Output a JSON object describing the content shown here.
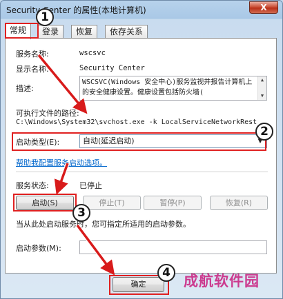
{
  "window": {
    "title": "Security Center 的属性(本地计算机)",
    "close_label": "X"
  },
  "tabs": [
    {
      "label": "常规",
      "active": true
    },
    {
      "label": "登录"
    },
    {
      "label": "恢复"
    },
    {
      "label": "依存关系"
    }
  ],
  "general": {
    "service_name_label": "服务名称:",
    "service_name_value": "wscsvc",
    "display_name_label": "显示名称:",
    "display_name_value": "Security Center",
    "description_label": "描述:",
    "description_text": "WSCSVC(Windows 安全中心)服务监视并报告计算机上的安全健康设置。健康设置包括防火墙(",
    "exe_path_label": "可执行文件的路径:",
    "exe_path_value": "C:\\Windows\\System32\\svchost.exe -k LocalServiceNetworkRest",
    "startup_type_label": "启动类型(E):",
    "startup_type_value": "自动(延迟启动)",
    "help_link": "帮助我配置服务启动选项。",
    "status_label": "服务状态:",
    "status_value": "已停止",
    "buttons": {
      "start": "启动(S)",
      "stop": "停止(T)",
      "pause": "暂停(P)",
      "resume": "恢复(R)"
    },
    "hint_text": "当从此处启动服务时，您可指定所适用的启动参数。",
    "params_label": "启动参数(M):"
  },
  "footer": {
    "ok_label": "确定"
  },
  "annotations": {
    "callouts": [
      "1",
      "2",
      "3",
      "4"
    ]
  },
  "watermark": "成航软件园"
}
